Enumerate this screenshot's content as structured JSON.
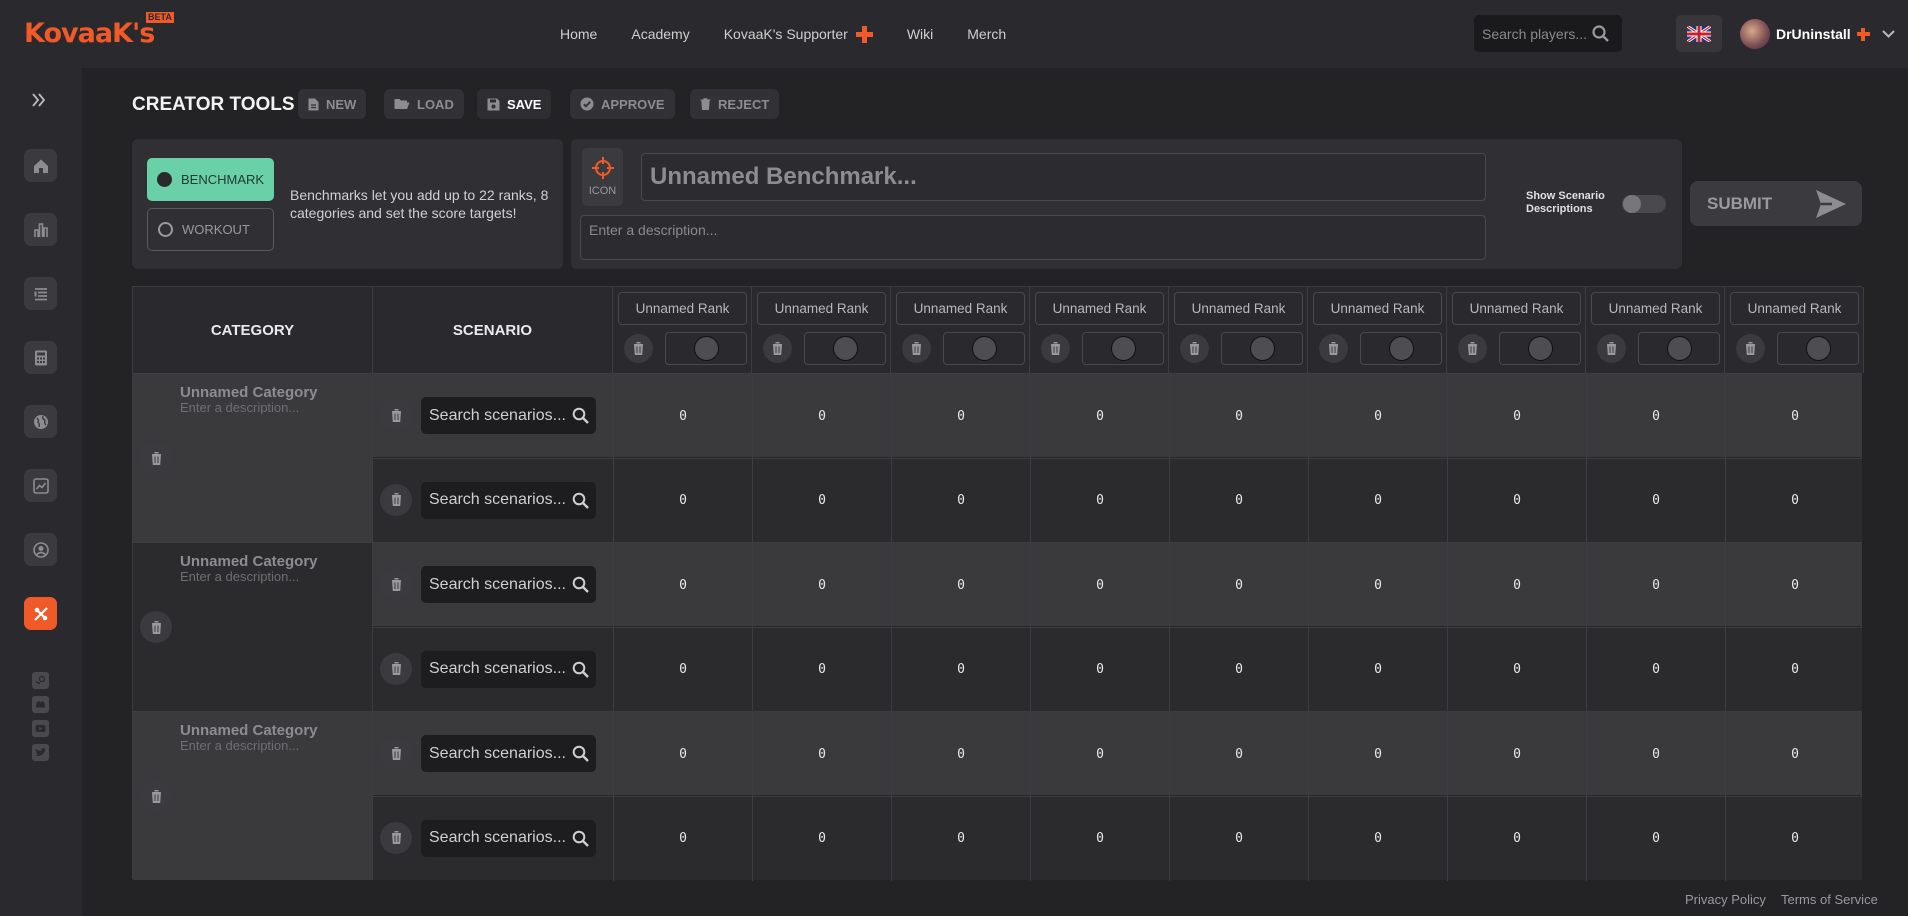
{
  "brand": {
    "logo": "KovaaK's",
    "beta": "BETA"
  },
  "nav": {
    "items": [
      "Home",
      "Academy",
      "KovaaK's Supporter",
      "Wiki",
      "Merch"
    ]
  },
  "search": {
    "placeholder": "Search players..."
  },
  "user": {
    "name": "DrUninstall"
  },
  "toolbar": {
    "title": "CREATOR TOOLS",
    "new": "NEW",
    "load": "LOAD",
    "save": "SAVE",
    "approve": "APPROVE",
    "reject": "REJECT"
  },
  "type": {
    "benchmark": "BENCHMARK",
    "workout": "WORKOUT",
    "description": "Benchmarks let you add up to 22 ranks, 8 categories and set the score targets!"
  },
  "benchmark": {
    "icon_label": "ICON",
    "name_placeholder": "Unnamed Benchmark...",
    "description_placeholder": "Enter a description..."
  },
  "options": {
    "show_scenario_descriptions": "Show Scenario Descriptions",
    "submit": "SUBMIT"
  },
  "table": {
    "headers": {
      "category": "CATEGORY",
      "scenario": "SCENARIO"
    },
    "ranks": [
      "Unnamed Rank",
      "Unnamed Rank",
      "Unnamed Rank",
      "Unnamed Rank",
      "Unnamed Rank",
      "Unnamed Rank",
      "Unnamed Rank",
      "Unnamed Rank",
      "Unnamed Rank"
    ],
    "categories": [
      {
        "name": "Unnamed Category",
        "description": "Enter a description..."
      },
      {
        "name": "Unnamed Category",
        "description": "Enter a description..."
      },
      {
        "name": "Unnamed Category",
        "description": "Enter a description..."
      }
    ],
    "scenario_placeholder": "Search scenarios...",
    "values": [
      [
        "0",
        "0",
        "0",
        "0",
        "0",
        "0",
        "0",
        "0",
        "0"
      ],
      [
        "0",
        "0",
        "0",
        "0",
        "0",
        "0",
        "0",
        "0",
        "0"
      ],
      [
        "0",
        "0",
        "0",
        "0",
        "0",
        "0",
        "0",
        "0",
        "0"
      ],
      [
        "0",
        "0",
        "0",
        "0",
        "0",
        "0",
        "0",
        "0",
        "0"
      ],
      [
        "0",
        "0",
        "0",
        "0",
        "0",
        "0",
        "0",
        "0",
        "0"
      ],
      [
        "0",
        "0",
        "0",
        "0",
        "0",
        "0",
        "0",
        "0",
        "0"
      ]
    ]
  },
  "footer": {
    "privacy": "Privacy Policy",
    "terms": "Terms of Service"
  },
  "colors": {
    "accent": "#f05a28",
    "benchmark_active": "#6ad0a8",
    "background": "#232225"
  }
}
